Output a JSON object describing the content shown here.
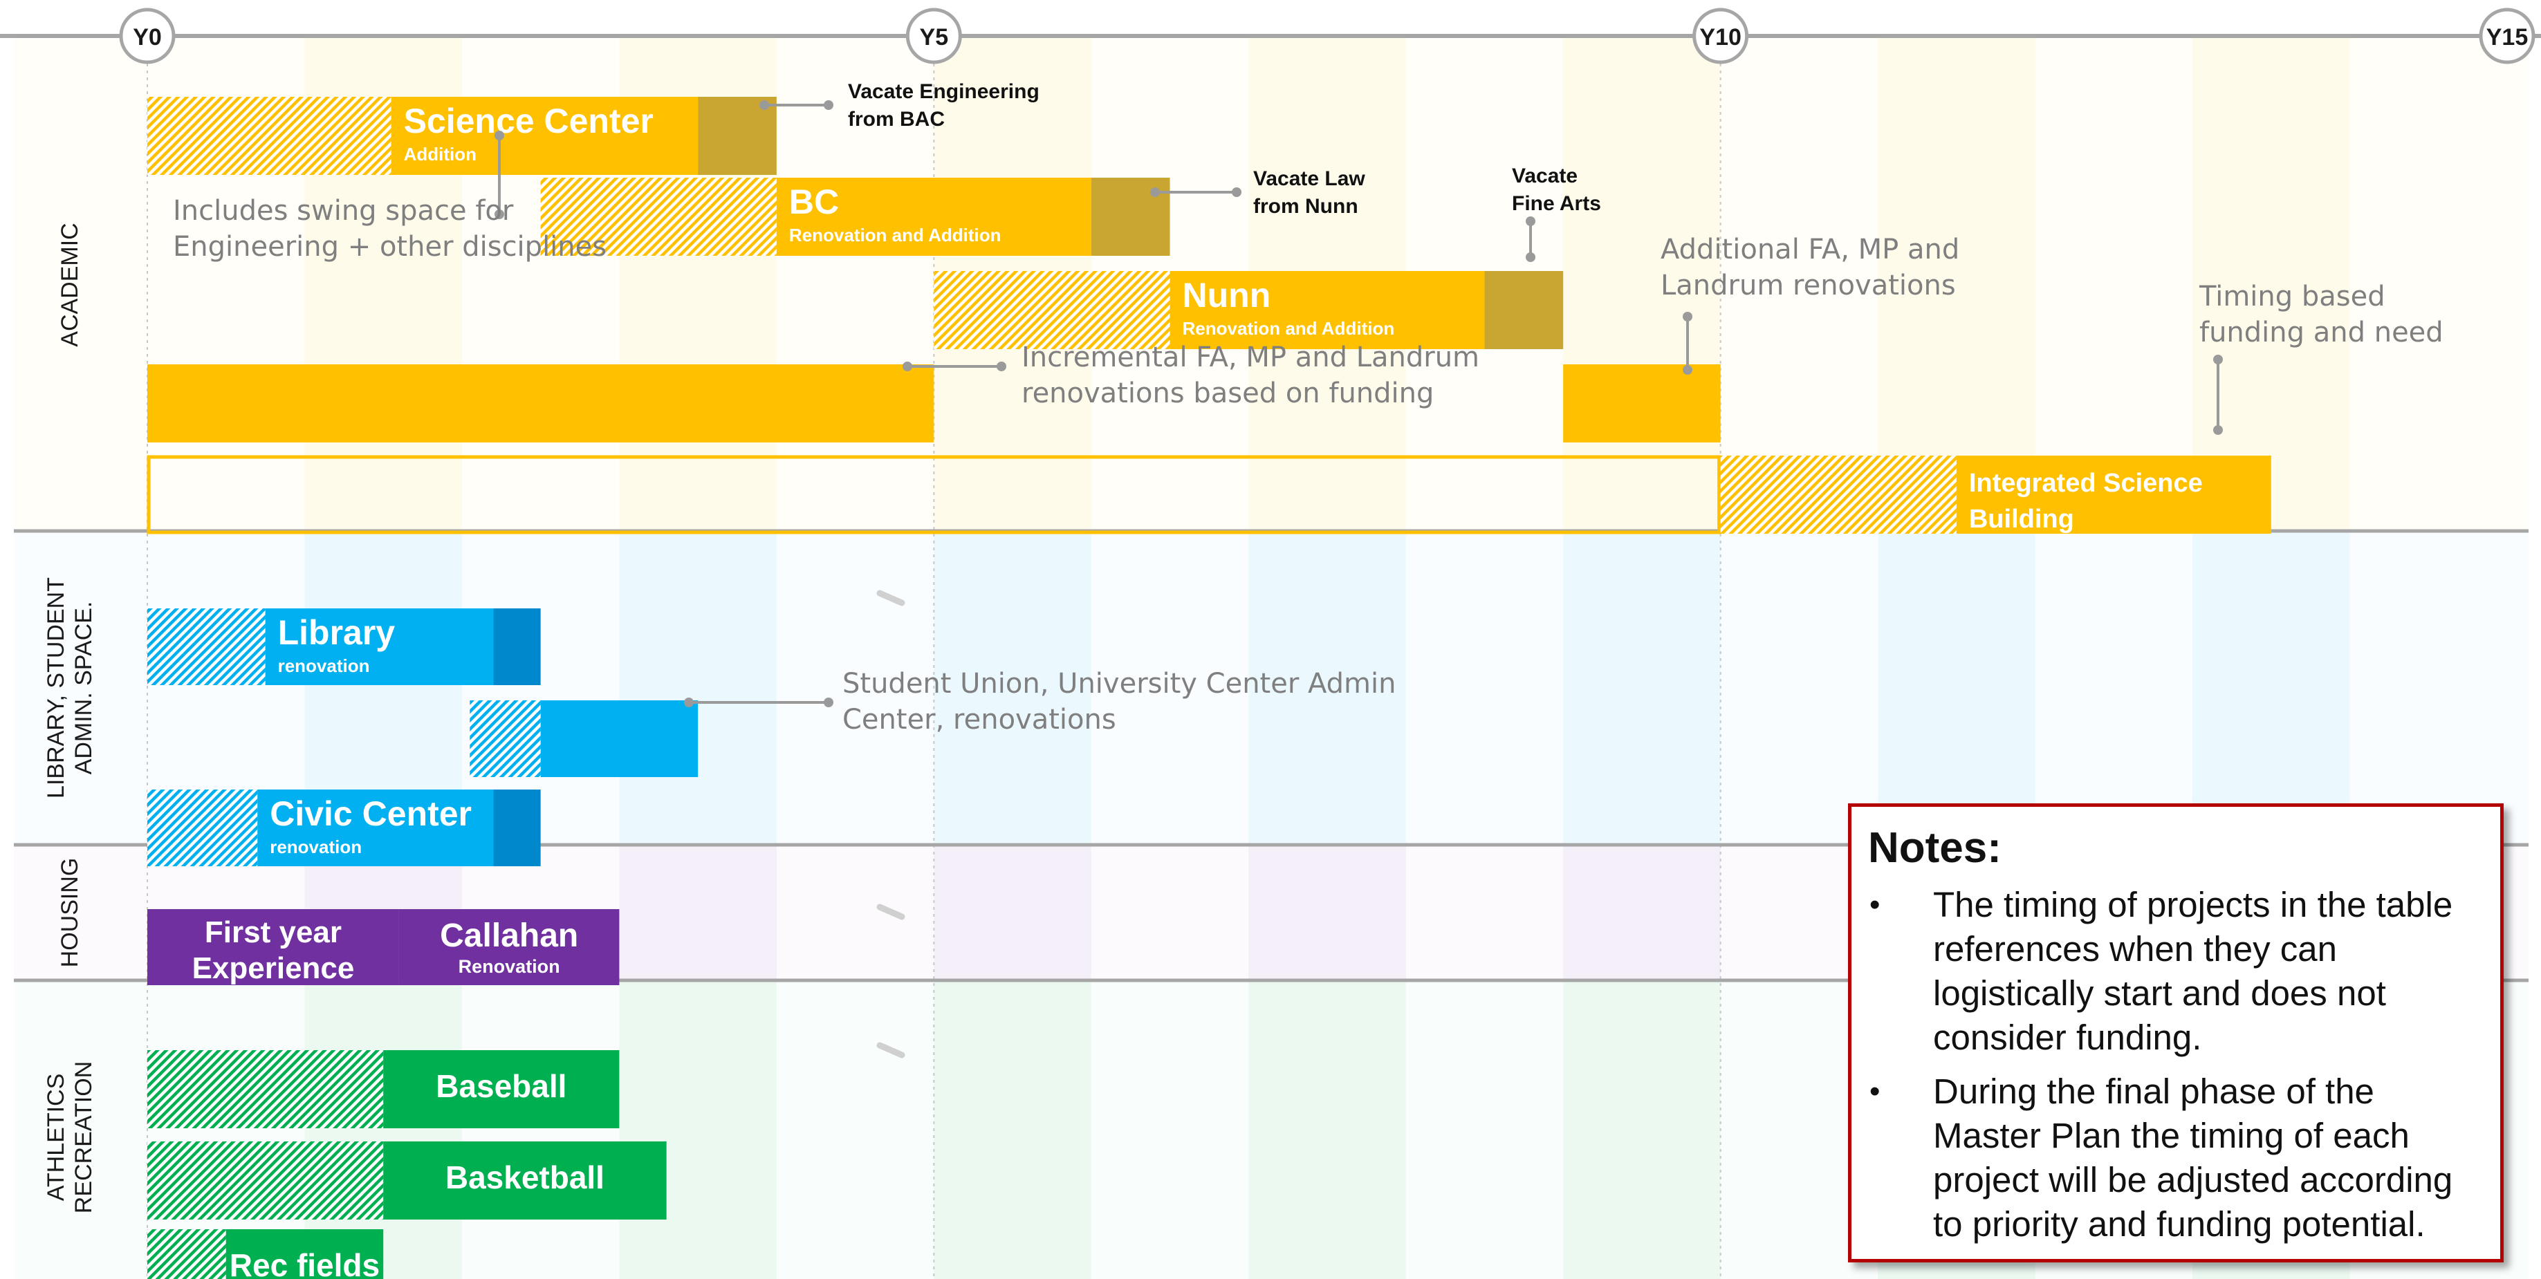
{
  "chart_data": {
    "type": "gantt",
    "time_axis": {
      "unit": "year",
      "min": 0,
      "max": 15,
      "ticks": [
        {
          "value": 0,
          "label": "Y0"
        },
        {
          "value": 5,
          "label": "Y5"
        },
        {
          "value": 10,
          "label": "Y10"
        },
        {
          "value": 15,
          "label": "Y15"
        }
      ]
    },
    "groups": [
      {
        "key": "academic",
        "label": [
          "ACADEMIC"
        ]
      },
      {
        "key": "library",
        "label": [
          "LIBRARY, STUDENT",
          "ADMIN. SPACE."
        ]
      },
      {
        "key": "housing",
        "label": [
          "HOUSING"
        ]
      },
      {
        "key": "athletics",
        "label": [
          "ATHLETICS",
          "RECREATION"
        ]
      }
    ],
    "colors": {
      "academic": "#FFC000",
      "academic_dark": "#C9A632",
      "library": "#00B0F0",
      "library_dark": "#0088CC",
      "housing": "#7030A0",
      "athletics": "#00B050",
      "athletics_dark": "#5A6E3C",
      "notes_border": "#B30000"
    },
    "projects": [
      {
        "group": "academic",
        "row": 0,
        "label": "Science Center",
        "sublabel": "Addition",
        "prep": [
          0,
          1.55
        ],
        "main": [
          1.55,
          3.5
        ],
        "transition": [
          3.5,
          4.0
        ]
      },
      {
        "group": "academic",
        "row": 1,
        "label": "BC",
        "sublabel": "Renovation and Addition",
        "prep": [
          2.5,
          4.0
        ],
        "main": [
          4.0,
          6.0
        ],
        "transition": [
          6.0,
          6.5
        ]
      },
      {
        "group": "academic",
        "row": 2,
        "label": "Nunn",
        "sublabel": "Renovation and Addition",
        "prep": [
          5.0,
          6.5
        ],
        "main": [
          6.5,
          8.5
        ],
        "transition": [
          8.5,
          9.0
        ]
      },
      {
        "group": "academic",
        "row": 3,
        "label": "",
        "sublabel": "",
        "main": [
          0,
          5.0
        ]
      },
      {
        "group": "academic",
        "row": 3,
        "label": "",
        "sublabel": "",
        "main": [
          9.0,
          10.0
        ]
      },
      {
        "group": "academic",
        "row": 4,
        "label": "Integrated Science",
        "label2": "Building",
        "outline": [
          0,
          10.0
        ],
        "prep": [
          10.0,
          11.5
        ],
        "main": [
          11.5,
          13.5
        ]
      },
      {
        "group": "library",
        "row": 0,
        "label": "Library",
        "sublabel": "renovation",
        "prep": [
          0,
          0.75
        ],
        "main": [
          0.75,
          2.2
        ],
        "transition": [
          2.2,
          2.5
        ]
      },
      {
        "group": "library",
        "row": 1,
        "label": "",
        "sublabel": "",
        "prep": [
          2.05,
          2.5
        ],
        "main": [
          2.5,
          3.5
        ]
      },
      {
        "group": "library",
        "row": 2,
        "label": "Civic Center",
        "sublabel": "renovation",
        "prep": [
          0,
          0.7
        ],
        "main": [
          0.7,
          2.2
        ],
        "transition": [
          2.2,
          2.5
        ]
      },
      {
        "group": "housing",
        "row": 0,
        "label": "First year",
        "label2": "Experience",
        "main": [
          0,
          1.6
        ]
      },
      {
        "group": "housing",
        "row": 0,
        "label": "Callahan",
        "sublabel": "Renovation",
        "main": [
          1.6,
          3.0
        ]
      },
      {
        "group": "athletics",
        "row": 0,
        "label": "Baseball",
        "prep": [
          0,
          1.5
        ],
        "main": [
          1.5,
          3.0
        ]
      },
      {
        "group": "athletics",
        "row": 1,
        "label": "Basketball",
        "prep": [
          0,
          1.5
        ],
        "main": [
          1.5,
          3.3
        ]
      },
      {
        "group": "athletics",
        "row": 2,
        "label": "Rec fields",
        "prep": [
          0,
          0.5
        ],
        "main": [
          0.5,
          1.5
        ]
      }
    ],
    "annotations": [
      {
        "group": "academic",
        "lines": [
          "Vacate Engineering",
          "from BAC"
        ],
        "style": "bold"
      },
      {
        "group": "academic",
        "lines": [
          "Vacate Law",
          "from Nunn"
        ],
        "style": "bold"
      },
      {
        "group": "academic",
        "lines": [
          "Vacate",
          "Fine Arts"
        ],
        "style": "bold"
      },
      {
        "group": "academic",
        "lines": [
          "Includes swing space for",
          "Engineering + other disciplines"
        ],
        "style": "light"
      },
      {
        "group": "academic",
        "lines": [
          "Incremental FA, MP and Landrum",
          "renovations based on funding"
        ],
        "style": "light"
      },
      {
        "group": "academic",
        "lines": [
          "Additional FA, MP and",
          "Landrum renovations"
        ],
        "style": "light"
      },
      {
        "group": "academic",
        "lines": [
          "Timing based",
          "funding and need"
        ],
        "style": "light"
      },
      {
        "group": "library",
        "lines": [
          "Student Union, University Center Admin",
          "Center, renovations"
        ],
        "style": "light"
      }
    ]
  },
  "notes": {
    "title": "Notes:",
    "items": [
      "The timing of projects in the table references when they can logistically start and does not consider funding.",
      "During the final phase of the Master Plan the timing of each project will be adjusted according to priority and funding potential."
    ]
  }
}
